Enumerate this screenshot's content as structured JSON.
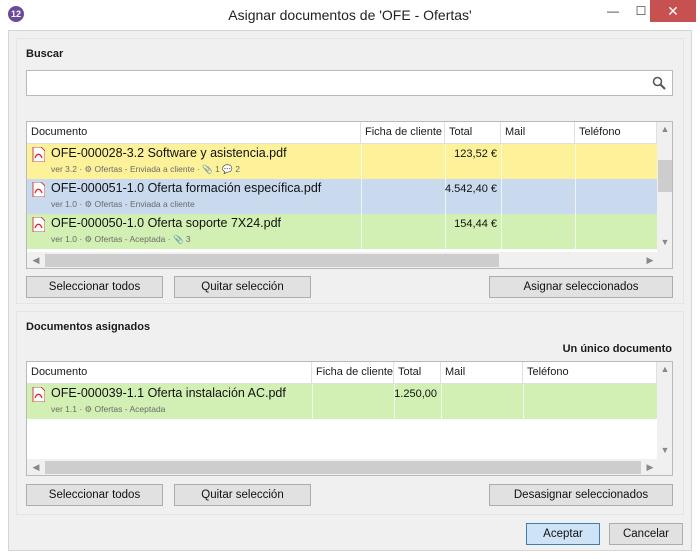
{
  "window": {
    "title": "Asignar documentos de 'OFE - Ofertas'",
    "app_icon_glyph": "12",
    "minimize_glyph": "—",
    "maximize_glyph": "☐",
    "close_glyph": "✕"
  },
  "search": {
    "label": "Buscar",
    "value": "",
    "placeholder": ""
  },
  "available_grid": {
    "columns": [
      "Documento",
      "Ficha de cliente",
      "Total",
      "Mail",
      "Teléfono"
    ],
    "rows": [
      {
        "title": "OFE-000028-3.2 Software y asistencia.pdf",
        "meta": "ver 3.2 · ⚙ Ofertas - Enviada a cliente · 📎 1 💬 2",
        "total": "123,52 €",
        "color": "#fdf29a"
      },
      {
        "title": "OFE-000051-1.0 Oferta formación específica.pdf",
        "meta": "ver 1.0 · ⚙ Ofertas - Enviada a cliente",
        "total": "4.542,40 €",
        "color": "#c9d9ee"
      },
      {
        "title": "OFE-000050-1.0 Oferta soporte 7X24.pdf",
        "meta": "ver 1.0 · ⚙ Ofertas - Aceptada · 📎 3",
        "total": "154,44 €",
        "color": "#d3f0b4"
      }
    ]
  },
  "top_buttons": {
    "select_all": "Seleccionar todos",
    "remove_selection": "Quitar selección",
    "assign_selected": "Asignar seleccionados"
  },
  "assigned": {
    "label": "Documentos asignados",
    "mode": "Un único documento",
    "columns": [
      "Documento",
      "Ficha de cliente",
      "Total",
      "Mail",
      "Teléfono"
    ],
    "rows": [
      {
        "title": "OFE-000039-1.1 Oferta instalación AC.pdf",
        "meta": "ver 1.1 · ⚙ Ofertas - Aceptada",
        "total": "1.250,00",
        "color": "#d3f0b4"
      }
    ]
  },
  "bottom_buttons": {
    "select_all": "Seleccionar todos",
    "remove_selection": "Quitar selección",
    "unassign_selected": "Desasignar seleccionados"
  },
  "footer": {
    "accept": "Aceptar",
    "cancel": "Cancelar"
  },
  "colors": {
    "accent": "#3c7fb1",
    "row_yellow": "#fdf29a",
    "row_blue": "#c9d9ee",
    "row_green": "#d3f0b4",
    "close_red": "#c75050"
  }
}
